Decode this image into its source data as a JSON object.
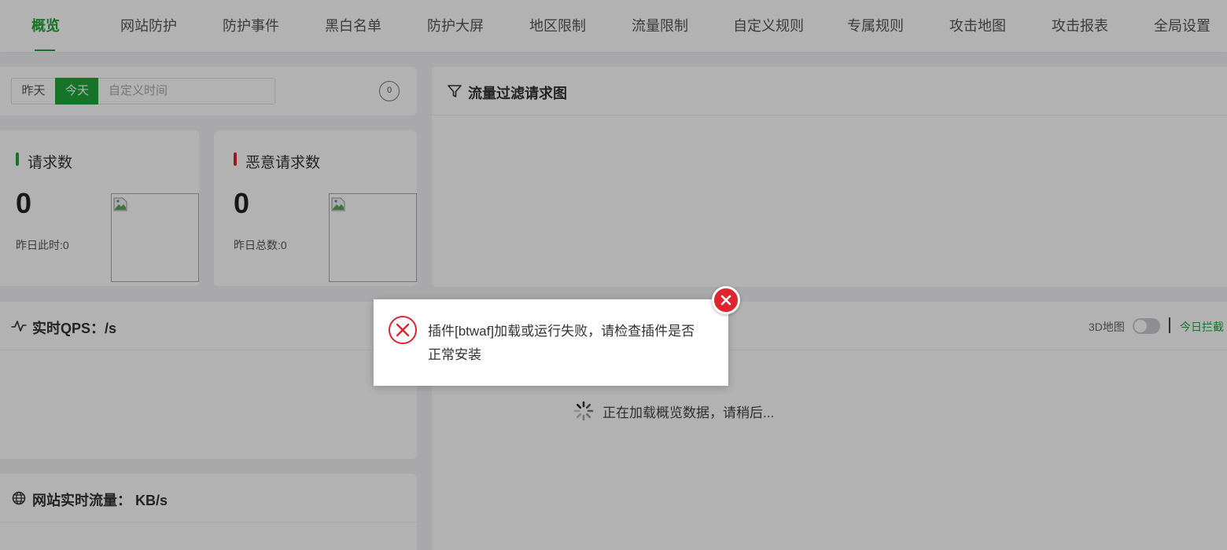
{
  "nav": {
    "items": [
      {
        "label": "概览",
        "active": true
      },
      {
        "label": "网站防护"
      },
      {
        "label": "防护事件"
      },
      {
        "label": "黑白名单"
      },
      {
        "label": "防护大屏"
      },
      {
        "label": "地区限制"
      },
      {
        "label": "流量限制"
      },
      {
        "label": "自定义规则"
      },
      {
        "label": "专属规则"
      },
      {
        "label": "攻击地图"
      },
      {
        "label": "攻击报表"
      },
      {
        "label": "全局设置"
      }
    ]
  },
  "date_filter": {
    "yesterday": "昨天",
    "today": "今天",
    "custom_placeholder": "自定义时间",
    "count": "0"
  },
  "stats": {
    "requests": {
      "label": "请求数",
      "value": "0",
      "sub": "昨日此时:0"
    },
    "malicious": {
      "label": "恶意请求数",
      "value": "0",
      "sub": "昨日总数:0"
    }
  },
  "panels": {
    "flow_filter_title": "流量过滤请求图",
    "qps_title": "实时QPS：/s",
    "traffic_title": "网站实时流量： KB/s",
    "map": {
      "toggle_label": "3D地图",
      "toggle_on": false,
      "today_blocked": "今日拦截",
      "loading": "正在加载概览数据，请稍后..."
    }
  },
  "dialog": {
    "message": "插件[btwaf]加载或运行失败，请检查插件是否正常安装"
  },
  "colors": {
    "accent": "#20a53a",
    "danger": "#e0242f",
    "requests_bar": "#20a53a",
    "malicious_bar": "#e0242f"
  }
}
